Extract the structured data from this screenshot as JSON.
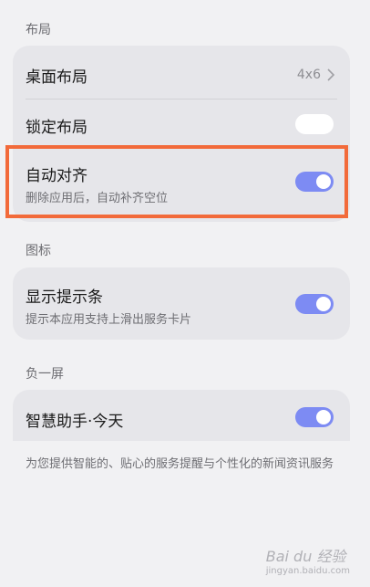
{
  "sections": {
    "layout": {
      "label": "布局",
      "desktop_layout": {
        "title": "桌面布局",
        "value": "4x6"
      },
      "lock_layout": {
        "title": "锁定布局",
        "toggle": "off"
      },
      "auto_align": {
        "title": "自动对齐",
        "subtitle": "删除应用后，自动补齐空位",
        "toggle": "on"
      }
    },
    "icons": {
      "label": "图标",
      "show_badge": {
        "title": "显示提示条",
        "subtitle": "提示本应用支持上滑出服务卡片",
        "toggle": "on"
      }
    },
    "minus_one": {
      "label": "负一屏",
      "smart_assistant": {
        "title": "智慧助手·今天",
        "toggle": "on"
      },
      "footnote": "为您提供智能的、贴心的服务提醒与个性化的新闻资讯服务"
    }
  },
  "colors": {
    "toggle_on": "#7d8bf3",
    "highlight_border": "#f26a3a",
    "background": "#f1f1f3",
    "card": "#e6e6ea"
  },
  "watermark": {
    "main": "Bai du 经验",
    "sub": "jingyan.baidu.com"
  }
}
